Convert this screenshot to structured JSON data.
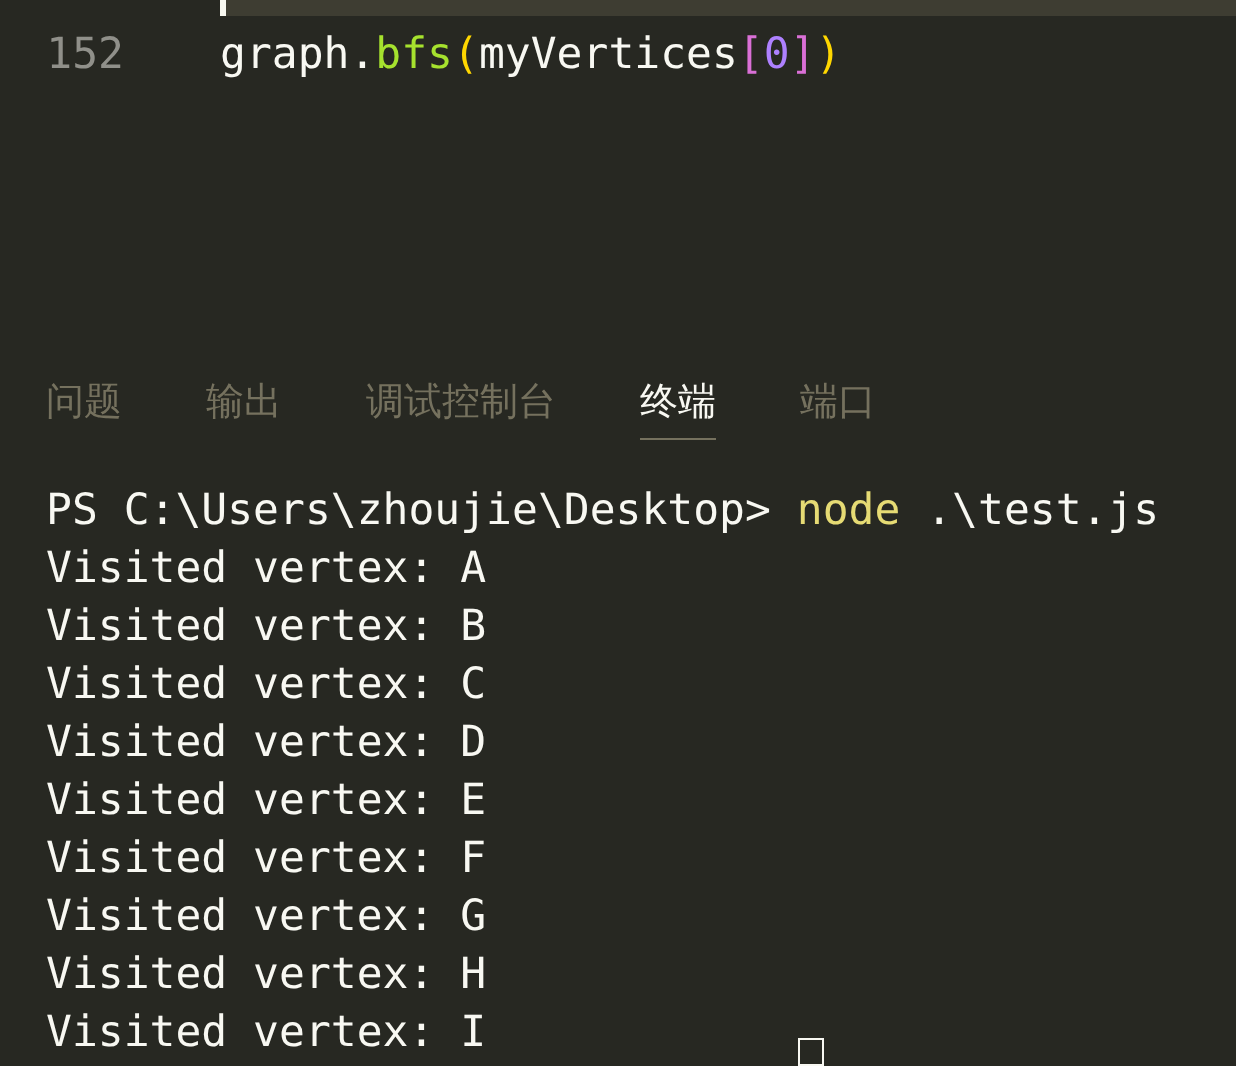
{
  "editor": {
    "lines": [
      {
        "number": "152",
        "tokens": [
          {
            "kind": "plain",
            "text": "graph."
          },
          {
            "kind": "function",
            "text": "bfs"
          },
          {
            "kind": "paren",
            "text": "("
          },
          {
            "kind": "plain",
            "text": "myVertices"
          },
          {
            "kind": "bracket",
            "text": "["
          },
          {
            "kind": "number",
            "text": "0"
          },
          {
            "kind": "bracket",
            "text": "]"
          },
          {
            "kind": "paren",
            "text": ")"
          }
        ]
      }
    ]
  },
  "panel": {
    "tabs": [
      {
        "label": "问题",
        "selected": false
      },
      {
        "label": "输出",
        "selected": false
      },
      {
        "label": "调试控制台",
        "selected": false
      },
      {
        "label": "终端",
        "selected": true
      },
      {
        "label": "端口",
        "selected": false
      }
    ]
  },
  "terminal": {
    "prompt": "PS C:\\Users\\zhoujie\\Desktop> ",
    "command": "node",
    "args": " .\\test.js",
    "output": [
      "Visited vertex: A",
      "Visited vertex: B",
      "Visited vertex: C",
      "Visited vertex: D",
      "Visited vertex: E",
      "Visited vertex: F",
      "Visited vertex: G",
      "Visited vertex: H",
      "Visited vertex: I"
    ]
  }
}
